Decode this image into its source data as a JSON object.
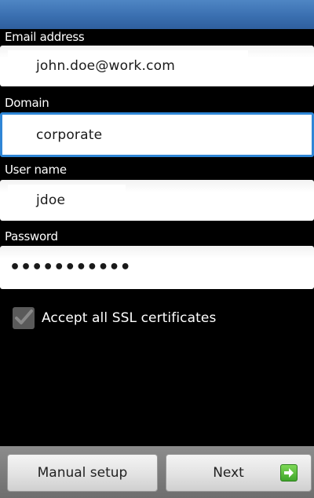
{
  "form": {
    "email": {
      "label": "Email address",
      "value": "john.doe@work.com"
    },
    "domain": {
      "label": "Domain",
      "value": "corporate"
    },
    "username": {
      "label": "User name",
      "value": "jdoe"
    },
    "password": {
      "label": "Password",
      "value": "•••••••••••"
    }
  },
  "ssl": {
    "label": "Accept all SSL certificates",
    "checked": true
  },
  "buttons": {
    "manual_setup": "Manual setup",
    "next": "Next"
  },
  "colors": {
    "title_bar": "#3a6fb0",
    "focus_border": "#2f86d6",
    "next_icon": "#3fa52a"
  },
  "icons": {
    "checkbox": "checkmark-icon",
    "next": "arrow-right-icon"
  }
}
